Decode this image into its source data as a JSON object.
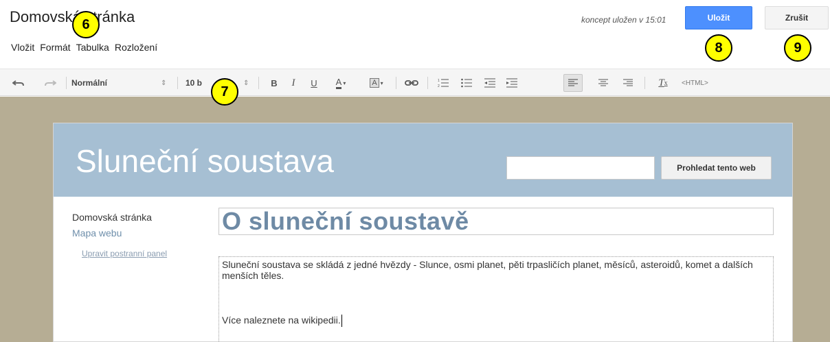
{
  "header": {
    "title": "Domovská stránka",
    "draft_status": "koncept uložen v 15:01",
    "save_label": "Uložit",
    "cancel_label": "Zrušit"
  },
  "menu": {
    "items": [
      "Vložit",
      "Formát",
      "Tabulka",
      "Rozložení"
    ]
  },
  "markers": [
    "6",
    "7",
    "8",
    "9"
  ],
  "toolbar": {
    "style_value": "Normální",
    "size_value": "10 b",
    "html_label": "<HTML>"
  },
  "site": {
    "title": "Sluneční soustava",
    "search_button": "Prohledat tento web",
    "search_value": "",
    "sidebar": {
      "home": "Domovská stránka",
      "sitemap": "Mapa webu",
      "edit_sidebar": "Upravit postranní panel"
    },
    "page_heading": "O sluneční soustavě",
    "body_text": "Sluneční soustava se skládá z jedné hvězdy - Slunce, osmi planet, pěti trpasličích planet, měsíců, asteroidů, komet a dalších menších těles.",
    "more_text": "Více naleznete na wikipedii."
  },
  "colors": {
    "accent_blue": "#4d90fe",
    "marker_yellow": "#ffff00",
    "site_header": "#a6bfd3",
    "canvas_bg": "#b6ad94"
  }
}
